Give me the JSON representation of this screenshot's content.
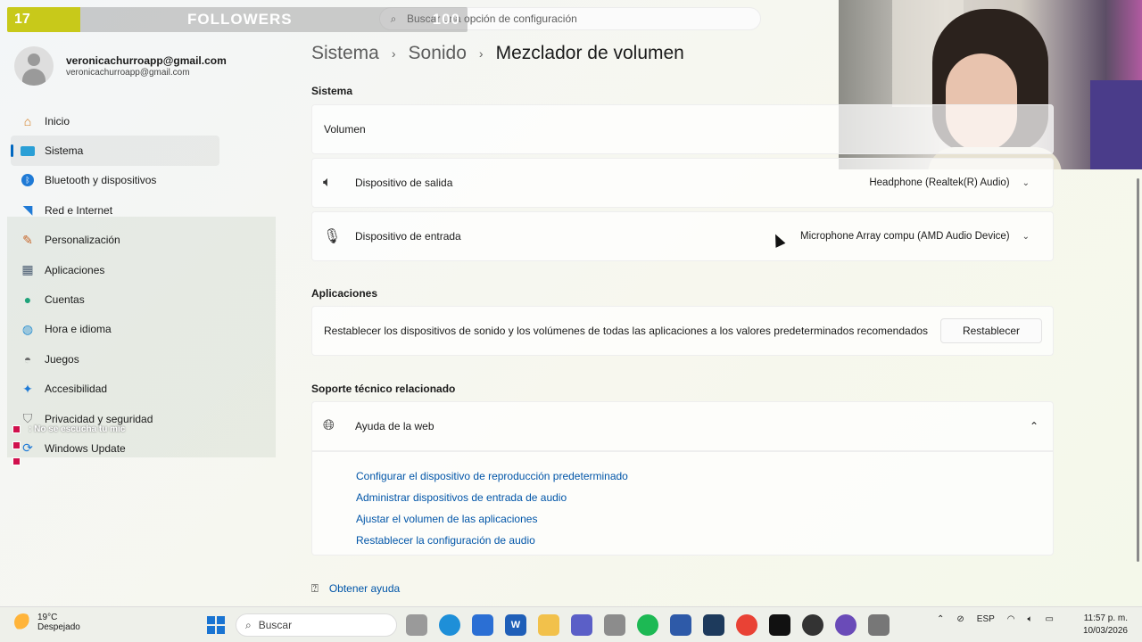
{
  "stream": {
    "follower_count": "17",
    "follower_title": "FOLLOWERS",
    "follower_goal": "100",
    "chat": [
      {
        "user": "",
        "message": ": No se escucha tu mic"
      },
      {
        "user": "",
        "message": ""
      },
      {
        "user": "",
        "message": ""
      }
    ]
  },
  "search": {
    "placeholder": "Buscar una opción de configuración"
  },
  "profile": {
    "name": "veronicachurroapp@gmail.com",
    "email": "veronicachurroapp@gmail.com"
  },
  "sidebar": {
    "items": [
      {
        "label": "Inicio",
        "icon": "home-icon"
      },
      {
        "label": "Sistema",
        "icon": "system-icon",
        "active": true
      },
      {
        "label": "Bluetooth y dispositivos",
        "icon": "bluetooth-icon"
      },
      {
        "label": "Red e Internet",
        "icon": "wifi-icon"
      },
      {
        "label": "Personalización",
        "icon": "brush-icon"
      },
      {
        "label": "Aplicaciones",
        "icon": "apps-icon"
      },
      {
        "label": "Cuentas",
        "icon": "accounts-icon"
      },
      {
        "label": "Hora e idioma",
        "icon": "globe-clock-icon"
      },
      {
        "label": "Juegos",
        "icon": "gamepad-icon"
      },
      {
        "label": "Accesibilidad",
        "icon": "accessibility-icon"
      },
      {
        "label": "Privacidad y seguridad",
        "icon": "shield-icon"
      },
      {
        "label": "Windows Update",
        "icon": "update-icon"
      }
    ]
  },
  "breadcrumb": {
    "level1": "Sistema",
    "level2": "Sonido",
    "current": "Mezclador de volumen"
  },
  "system_section": {
    "label": "Sistema",
    "volume_label": "Volumen",
    "output_label": "Dispositivo de salida",
    "output_value": "Headphone (Realtek(R) Audio)",
    "input_label": "Dispositivo de entrada",
    "input_value": "Microphone Array compu (AMD Audio Device)"
  },
  "apps_section": {
    "label": "Aplicaciones",
    "reset_text": "Restablecer los dispositivos de sonido y los volúmenes de todas las aplicaciones a los valores predeterminados recomendados",
    "reset_button": "Restablecer"
  },
  "support_section": {
    "label": "Soporte técnico relacionado",
    "help_web": "Ayuda de la web",
    "links": [
      "Configurar el dispositivo de reproducción predeterminado",
      "Administrar dispositivos de entrada de audio",
      "Ajustar el volumen de las aplicaciones",
      "Restablecer la configuración de audio"
    ],
    "get_help": "Obtener ayuda"
  },
  "taskbar": {
    "weather_temp": "19°C",
    "weather_desc": "Despejado",
    "search_label": "Buscar",
    "language": "ESP",
    "time": "11:57 p. m.",
    "date": "10/03/2026"
  },
  "colors": {
    "accent": "#0067c0",
    "link": "#0055a8",
    "follower_bar": "#c8c91a"
  }
}
